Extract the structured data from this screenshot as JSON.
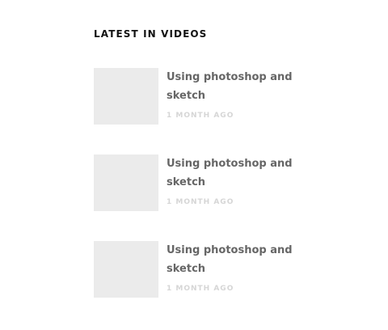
{
  "widget": {
    "title": "LATEST IN VIDEOS",
    "posts": [
      {
        "title": "Using photoshop and sketch",
        "meta": "1 MONTH AGO",
        "thumb_color": "#ebebeb"
      },
      {
        "title": "Using photoshop and sketch",
        "meta": "1 MONTH AGO",
        "thumb_color": "#ebebeb"
      },
      {
        "title": "Using photoshop and sketch",
        "meta": "1 MONTH AGO",
        "thumb_color": "#ebebeb"
      }
    ]
  },
  "colors": {
    "heading": "#111111",
    "post_title": "#666666",
    "meta": "#d6d6d6",
    "thumbnail": "#ebebeb"
  }
}
